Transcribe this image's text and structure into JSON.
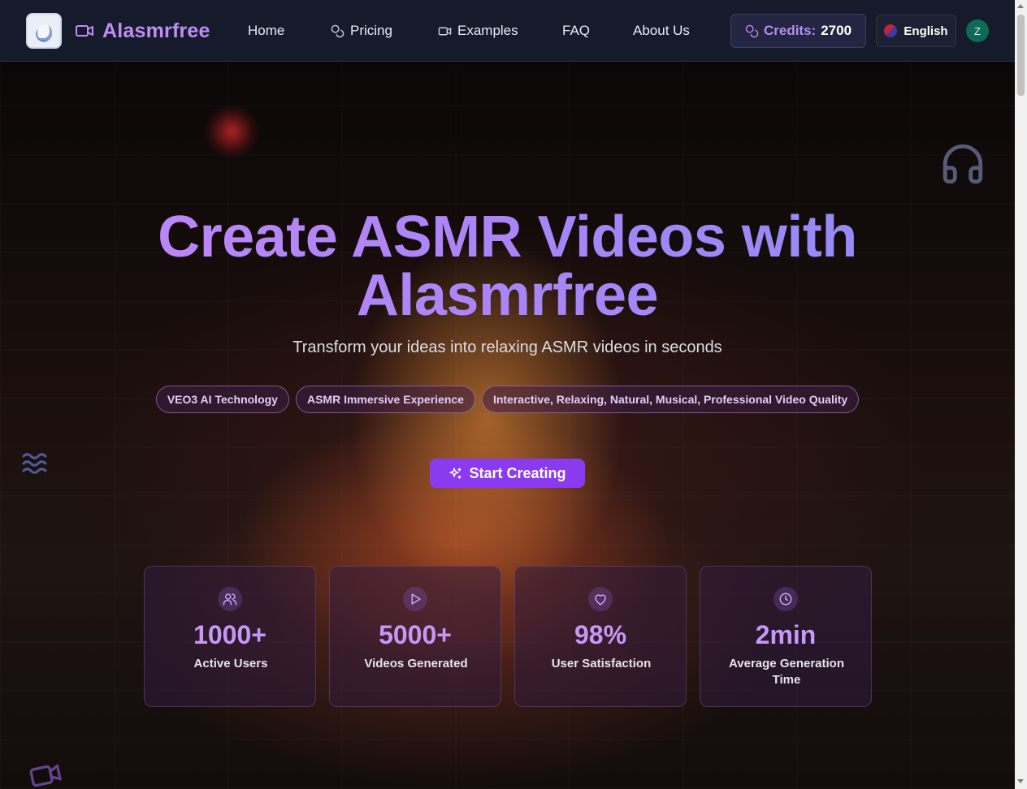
{
  "nav": {
    "brand": "Alasmrfree",
    "items": [
      {
        "label": "Home",
        "icon": ""
      },
      {
        "label": "Pricing",
        "icon": "coins-icon"
      },
      {
        "label": "Examples",
        "icon": "video-icon"
      },
      {
        "label": "FAQ",
        "icon": ""
      },
      {
        "label": "About Us",
        "icon": ""
      }
    ],
    "credits_label": "Credits:",
    "credits_value": "2700",
    "language": "English",
    "avatar_initial": "Z"
  },
  "hero": {
    "title_line1": "Create ASMR Videos with",
    "title_line2": "Alasmrfree",
    "subtitle": "Transform your ideas into relaxing ASMR videos in seconds",
    "tags": [
      "VEO3 AI Technology",
      "ASMR Immersive Experience",
      "Interactive, Relaxing, Natural, Musical, Professional Video Quality"
    ],
    "cta_label": "Start Creating"
  },
  "stats": [
    {
      "value": "1000+",
      "label": "Active Users",
      "icon": "users-icon"
    },
    {
      "value": "5000+",
      "label": "Videos Generated",
      "icon": "play-icon"
    },
    {
      "value": "98%",
      "label": "User Satisfaction",
      "icon": "heart-icon"
    },
    {
      "value": "2min",
      "label": "Average Generation Time",
      "icon": "clock-icon"
    }
  ],
  "colors": {
    "accent": "#8a3bef",
    "brand_text": "#c28cf5",
    "nav_bg": "#161b2c"
  }
}
